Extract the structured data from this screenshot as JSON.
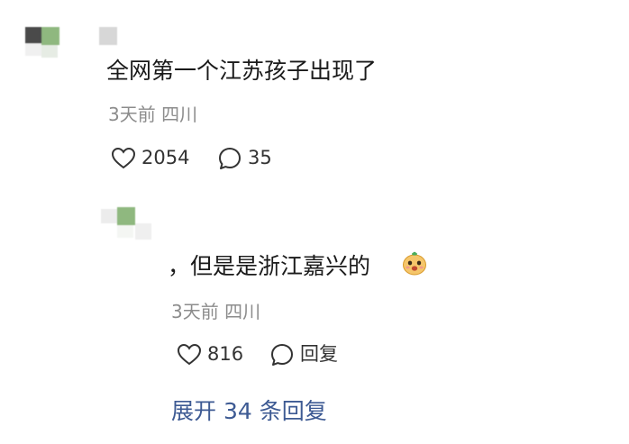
{
  "comment": {
    "text": "全网第一个江苏孩子出现了",
    "meta": "3天前 四川",
    "likes": "2054",
    "replies": "35"
  },
  "reply": {
    "text": "，但是是浙江嘉兴的",
    "emoji": "smiling-face-emoji",
    "meta": "3天前 四川",
    "likes": "816",
    "reply_label": "回复"
  },
  "expand_label": "展开 34 条回复",
  "colors": {
    "text": "#1a1a1a",
    "meta": "#8c8c8c",
    "link": "#3d5a93",
    "avatar_green": "#8fb87f",
    "avatar_gray": "#555555"
  }
}
